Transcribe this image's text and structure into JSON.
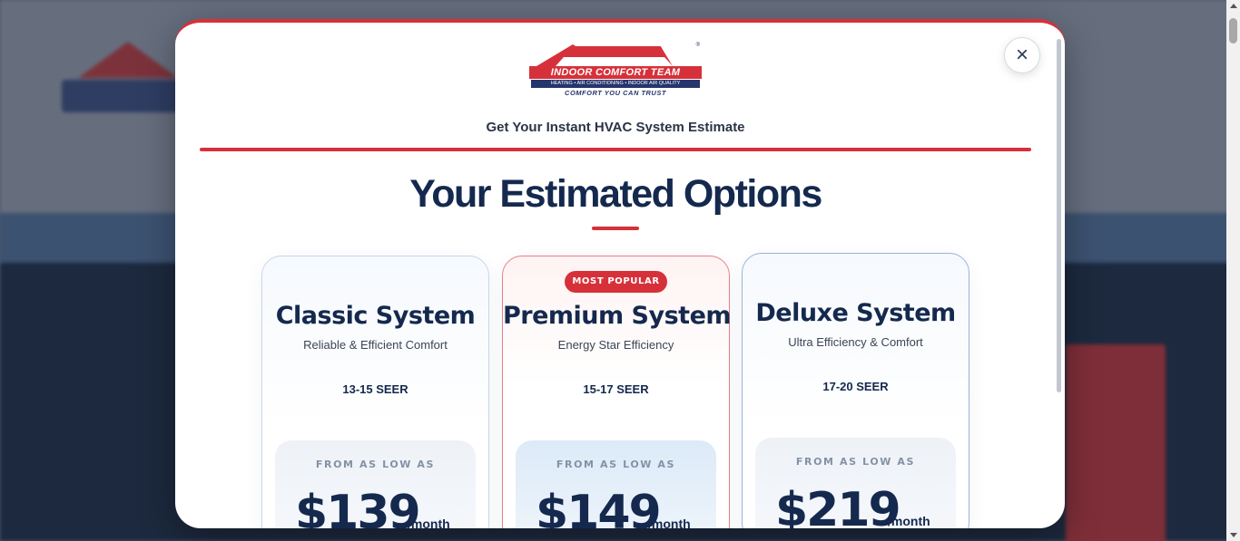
{
  "modal": {
    "close_label": "×",
    "brand": {
      "name": "INDOOR COMFORT TEAM",
      "services": "HEATING • AIR CONDITIONING • INDOOR AIR QUALITY",
      "tagline": "COMFORT YOU CAN TRUST",
      "registered": "®"
    },
    "subtitle": "Get Your Instant HVAC System Estimate",
    "heading": "Your Estimated Options"
  },
  "plans": [
    {
      "title": "Classic System",
      "description": "Reliable & Efficient Comfort",
      "seer": "13-15 SEER",
      "price_label": "FROM AS LOW AS",
      "price": "$139",
      "unit": "/month",
      "badge": ""
    },
    {
      "title": "Premium System",
      "description": "Energy Star Efficiency",
      "seer": "15-17 SEER",
      "price_label": "FROM AS LOW AS",
      "price": "$149",
      "unit": "/month",
      "badge": "MOST POPULAR"
    },
    {
      "title": "Deluxe System",
      "description": "Ultra Efficiency & Comfort",
      "seer": "17-20 SEER",
      "price_label": "FROM AS LOW AS",
      "price": "$219",
      "unit": "/month",
      "badge": ""
    }
  ],
  "colors": {
    "brand_red": "#d6313a",
    "navy": "#14294d",
    "muted": "#8492a6"
  }
}
